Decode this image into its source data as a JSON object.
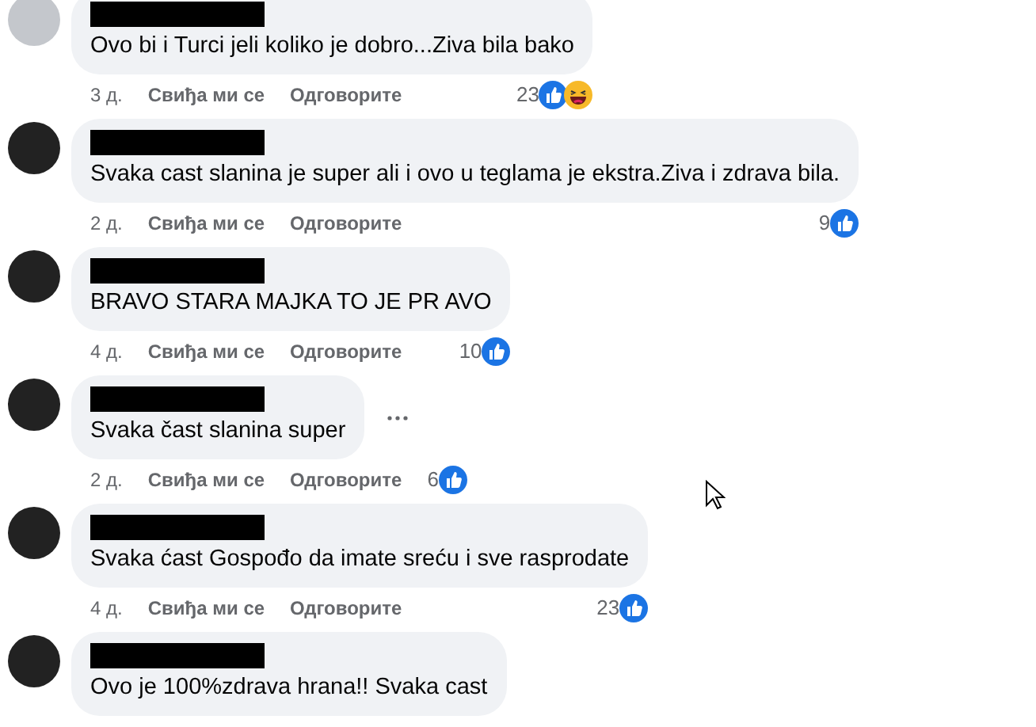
{
  "comments": [
    {
      "text": "Ovo bi i Turci jeli koliko je dobro...Ziva bila bako",
      "avatar": {
        "kind": "default"
      },
      "more_button": false,
      "time": "3 д.",
      "like_label": "Свиђа ми се",
      "reply_label": "Одговорите",
      "reactions_count": "23",
      "reactions": [
        {
          "kind": "like"
        },
        {
          "kind": "haha"
        }
      ]
    },
    {
      "text": "Svaka cast slanina je super ali i ovo u teglama je ekstra.Ziva i zdrava bila.",
      "avatar": {
        "kind": "dark"
      },
      "more_button": false,
      "time": "2 д.",
      "like_label": "Свиђа ми се",
      "reply_label": "Одговорите",
      "reactions_count": "9",
      "reactions": [
        {
          "kind": "like"
        }
      ]
    },
    {
      "text": "BRAVO STARA MAJKA TO JE PR AVO",
      "avatar": {
        "kind": "dark"
      },
      "more_button": false,
      "time": "4 д.",
      "like_label": "Свиђа ми се",
      "reply_label": "Одговорите",
      "reactions_count": "10",
      "reactions": [
        {
          "kind": "like"
        }
      ]
    },
    {
      "text": "Svaka čast slanina super",
      "avatar": {
        "kind": "dark"
      },
      "more_button": true,
      "time": "2 д.",
      "like_label": "Свиђа ми се",
      "reply_label": "Одговорите",
      "reactions_count": "6",
      "reactions": [
        {
          "kind": "like"
        }
      ]
    },
    {
      "text": "Svaka ćast Gospođo da imate sreću i sve rasprodate",
      "avatar": {
        "kind": "dark"
      },
      "more_button": false,
      "time": "4 д.",
      "like_label": "Свиђа ми се",
      "reply_label": "Одговорите",
      "reactions_count": "23",
      "reactions": [
        {
          "kind": "like"
        }
      ]
    },
    {
      "text": "Ovo je 100%zdrava hrana!! Svaka cast",
      "avatar": {
        "kind": "dark"
      },
      "more_button": false
    }
  ]
}
